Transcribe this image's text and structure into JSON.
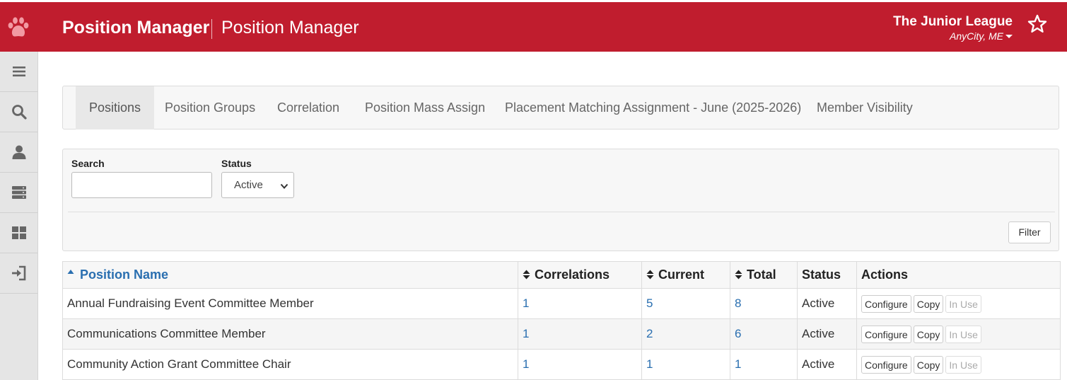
{
  "header": {
    "app_title": "Position Manager",
    "page_title": "Position Manager",
    "org_name": "The Junior League",
    "org_city": "AnyCity, ME"
  },
  "colors": {
    "brand": "#c01d2e",
    "link": "#2a6fb0"
  },
  "sidebar": {
    "items": [
      {
        "icon": "menu-icon"
      },
      {
        "icon": "search-icon"
      },
      {
        "icon": "user-icon"
      },
      {
        "icon": "server-icon"
      },
      {
        "icon": "dashboard-icon"
      },
      {
        "icon": "sign-in-icon"
      }
    ]
  },
  "tabs": [
    {
      "label": "Positions",
      "active": true
    },
    {
      "label": "Position Groups"
    },
    {
      "label": "Correlation"
    },
    {
      "label": "Position Mass Assign"
    },
    {
      "label": "Placement Matching Assignment - June (2025-2026)"
    },
    {
      "label": "Member Visibility"
    }
  ],
  "filter": {
    "search_label": "Search",
    "search_value": "",
    "status_label": "Status",
    "status_value": "Active",
    "button_label": "Filter"
  },
  "table": {
    "columns": [
      "Position Name",
      "Correlations",
      "Current",
      "Total",
      "Status",
      "Actions"
    ],
    "rows": [
      {
        "name": "Annual Fundraising Event Committee Member",
        "correlations": "1",
        "current": "5",
        "total": "8",
        "status": "Active"
      },
      {
        "name": "Communications Committee Member",
        "correlations": "1",
        "current": "2",
        "total": "6",
        "status": "Active"
      },
      {
        "name": "Community Action Grant Committee Chair",
        "correlations": "1",
        "current": "1",
        "total": "1",
        "status": "Active"
      }
    ],
    "actions": {
      "configure": "Configure",
      "copy": "Copy",
      "in_use": "In Use"
    }
  }
}
